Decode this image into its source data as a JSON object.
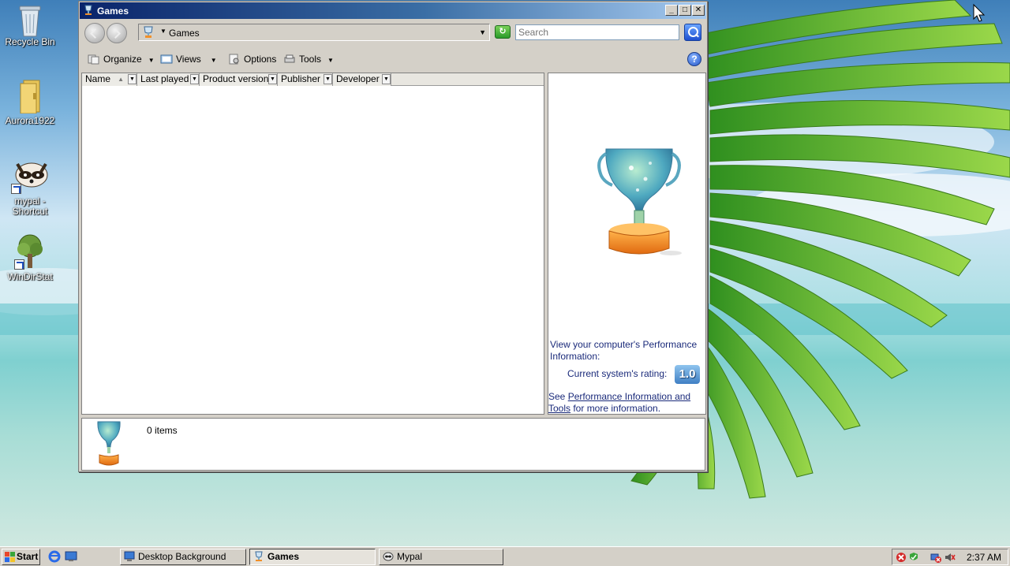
{
  "desktop": {
    "icons": [
      {
        "label": "Recycle Bin",
        "icon": "recycle-bin-icon"
      },
      {
        "label": "Aurora1922",
        "icon": "folder-icon"
      },
      {
        "label": "mypal - Shortcut",
        "icon": "raccoon-icon"
      },
      {
        "label": "WinDirStat",
        "icon": "tree-icon"
      }
    ]
  },
  "window": {
    "title": "Games",
    "title_buttons": [
      "minimize",
      "maximize",
      "close"
    ],
    "address": "Games",
    "search_placeholder": "Search",
    "commands": [
      {
        "label": "Organize",
        "icon": "organize-icon"
      },
      {
        "label": "Views",
        "icon": "views-icon"
      },
      {
        "label": "Options",
        "icon": "options-icon"
      },
      {
        "label": "Tools",
        "icon": "tools-icon"
      }
    ],
    "columns": [
      "Name",
      "Last played",
      "Product version",
      "Publisher",
      "Developer"
    ],
    "preview": {
      "perf_line": "View your computer's Performance Information:",
      "rating_label": "Current system's rating:",
      "rating_value": "1.0",
      "see_prefix": "See ",
      "see_link": "Performance Information and Tools",
      "see_suffix": " for more information."
    },
    "status": {
      "items": "0 items"
    }
  },
  "taskbar": {
    "start": "Start",
    "tasks": [
      {
        "label": "Desktop Background",
        "active": false
      },
      {
        "label": "Games",
        "active": true
      },
      {
        "label": "Mypal",
        "active": false
      }
    ],
    "clock": "2:37 AM"
  },
  "colors": {
    "title_gradient_start": "#0a246a",
    "title_gradient_end": "#a6caf0",
    "chrome": "#d4d0c8",
    "link": "#1a2a7a"
  }
}
